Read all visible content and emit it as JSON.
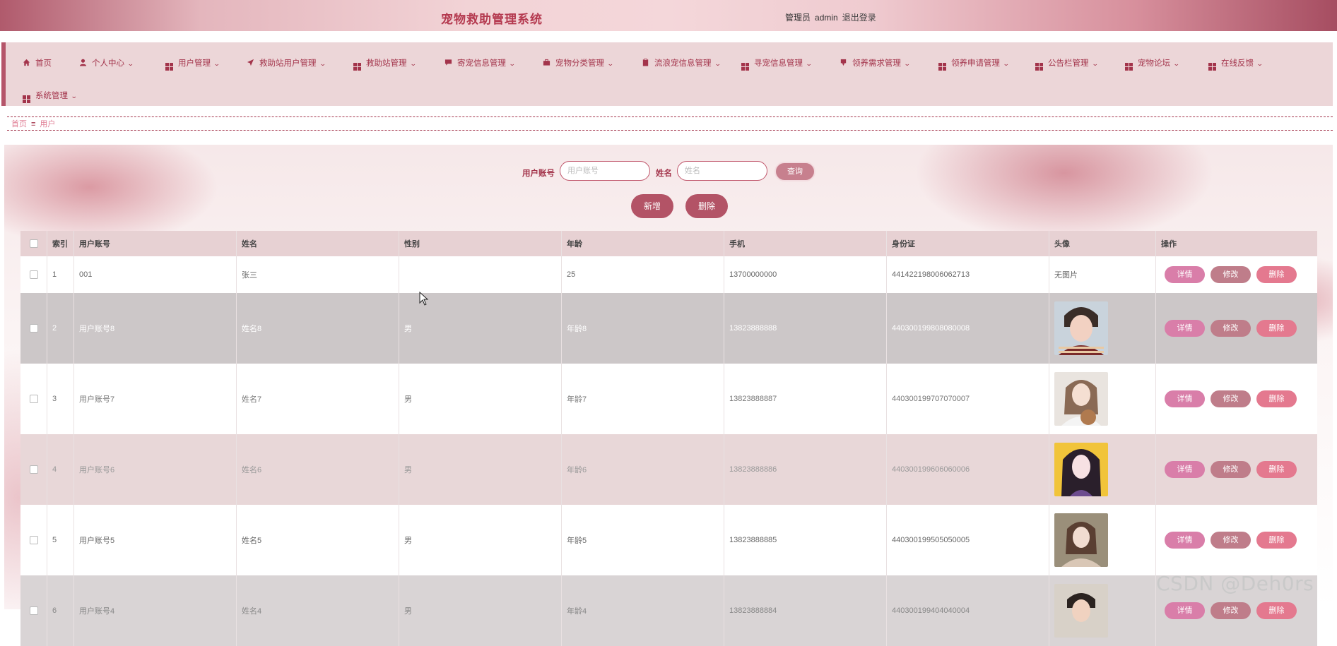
{
  "header": {
    "title": "宠物救助管理系统",
    "role": "管理员",
    "username": "admin",
    "logout": "退出登录"
  },
  "nav": {
    "items": [
      {
        "label": "首页",
        "icon": "home-icon"
      },
      {
        "label": "个人中心",
        "icon": "user-icon"
      },
      {
        "label": "用户管理",
        "icon": "grid-icon"
      },
      {
        "label": "救助站用户管理",
        "icon": "send-icon"
      },
      {
        "label": "救助站管理",
        "icon": "grid-icon"
      },
      {
        "label": "寄宠信息管理",
        "icon": "comment-icon"
      },
      {
        "label": "宠物分类管理",
        "icon": "briefcase-icon"
      },
      {
        "label": "流浪宠信息管理",
        "icon": "clipboard-icon"
      },
      {
        "label": "寻宠信息管理",
        "icon": "grid-icon"
      },
      {
        "label": "领养需求管理",
        "icon": "badge-icon"
      },
      {
        "label": "领养申请管理",
        "icon": "grid-icon"
      },
      {
        "label": "公告栏管理",
        "icon": "grid-icon"
      },
      {
        "label": "宠物论坛",
        "icon": "grid-icon"
      },
      {
        "label": "在线反馈",
        "icon": "grid-icon"
      },
      {
        "label": "系统管理",
        "icon": "grid-icon"
      }
    ]
  },
  "breadcrumb": {
    "home": "首页",
    "sep": "≡",
    "current": "用户"
  },
  "search": {
    "account_label": "用户账号",
    "account_placeholder": "用户账号",
    "account_value": "",
    "name_label": "姓名",
    "name_placeholder": "姓名",
    "name_value": "",
    "query_button": "查询"
  },
  "actions": {
    "add": "新增",
    "delete": "删除"
  },
  "table": {
    "columns": [
      "索引",
      "用户账号",
      "姓名",
      "性别",
      "年龄",
      "手机",
      "身份证",
      "头像",
      "操作"
    ],
    "rows": [
      {
        "index": "1",
        "account": "001",
        "name": "张三",
        "gender": "",
        "age": "25",
        "phone": "13700000000",
        "id_card": "441422198006062713",
        "avatar": "无图片"
      },
      {
        "index": "2",
        "account": "用户账号8",
        "name": "姓名8",
        "gender": "男",
        "age": "年龄8",
        "phone": "13823888888",
        "id_card": "440300199808080008",
        "avatar": ""
      },
      {
        "index": "3",
        "account": "用户账号7",
        "name": "姓名7",
        "gender": "男",
        "age": "年龄7",
        "phone": "13823888887",
        "id_card": "440300199707070007",
        "avatar": ""
      },
      {
        "index": "4",
        "account": "用户账号6",
        "name": "姓名6",
        "gender": "男",
        "age": "年龄6",
        "phone": "13823888886",
        "id_card": "440300199606060006",
        "avatar": ""
      },
      {
        "index": "5",
        "account": "用户账号5",
        "name": "姓名5",
        "gender": "男",
        "age": "年龄5",
        "phone": "13823888885",
        "id_card": "440300199505050005",
        "avatar": ""
      },
      {
        "index": "6",
        "account": "用户账号4",
        "name": "姓名4",
        "gender": "男",
        "age": "年龄4",
        "phone": "13823888884",
        "id_card": "440300199404040004",
        "avatar": ""
      }
    ],
    "row_buttons": {
      "detail": "详情",
      "edit": "修改",
      "delete": "删除"
    }
  },
  "watermark": "CSDN @Deh0rs",
  "colors": {
    "accent": "#a3344b",
    "nav_bg": "#ecd6d8",
    "header_bg": "#f2d3d6",
    "selected_row": "#ccc7c8",
    "alt_row": "#e8d7d8"
  }
}
